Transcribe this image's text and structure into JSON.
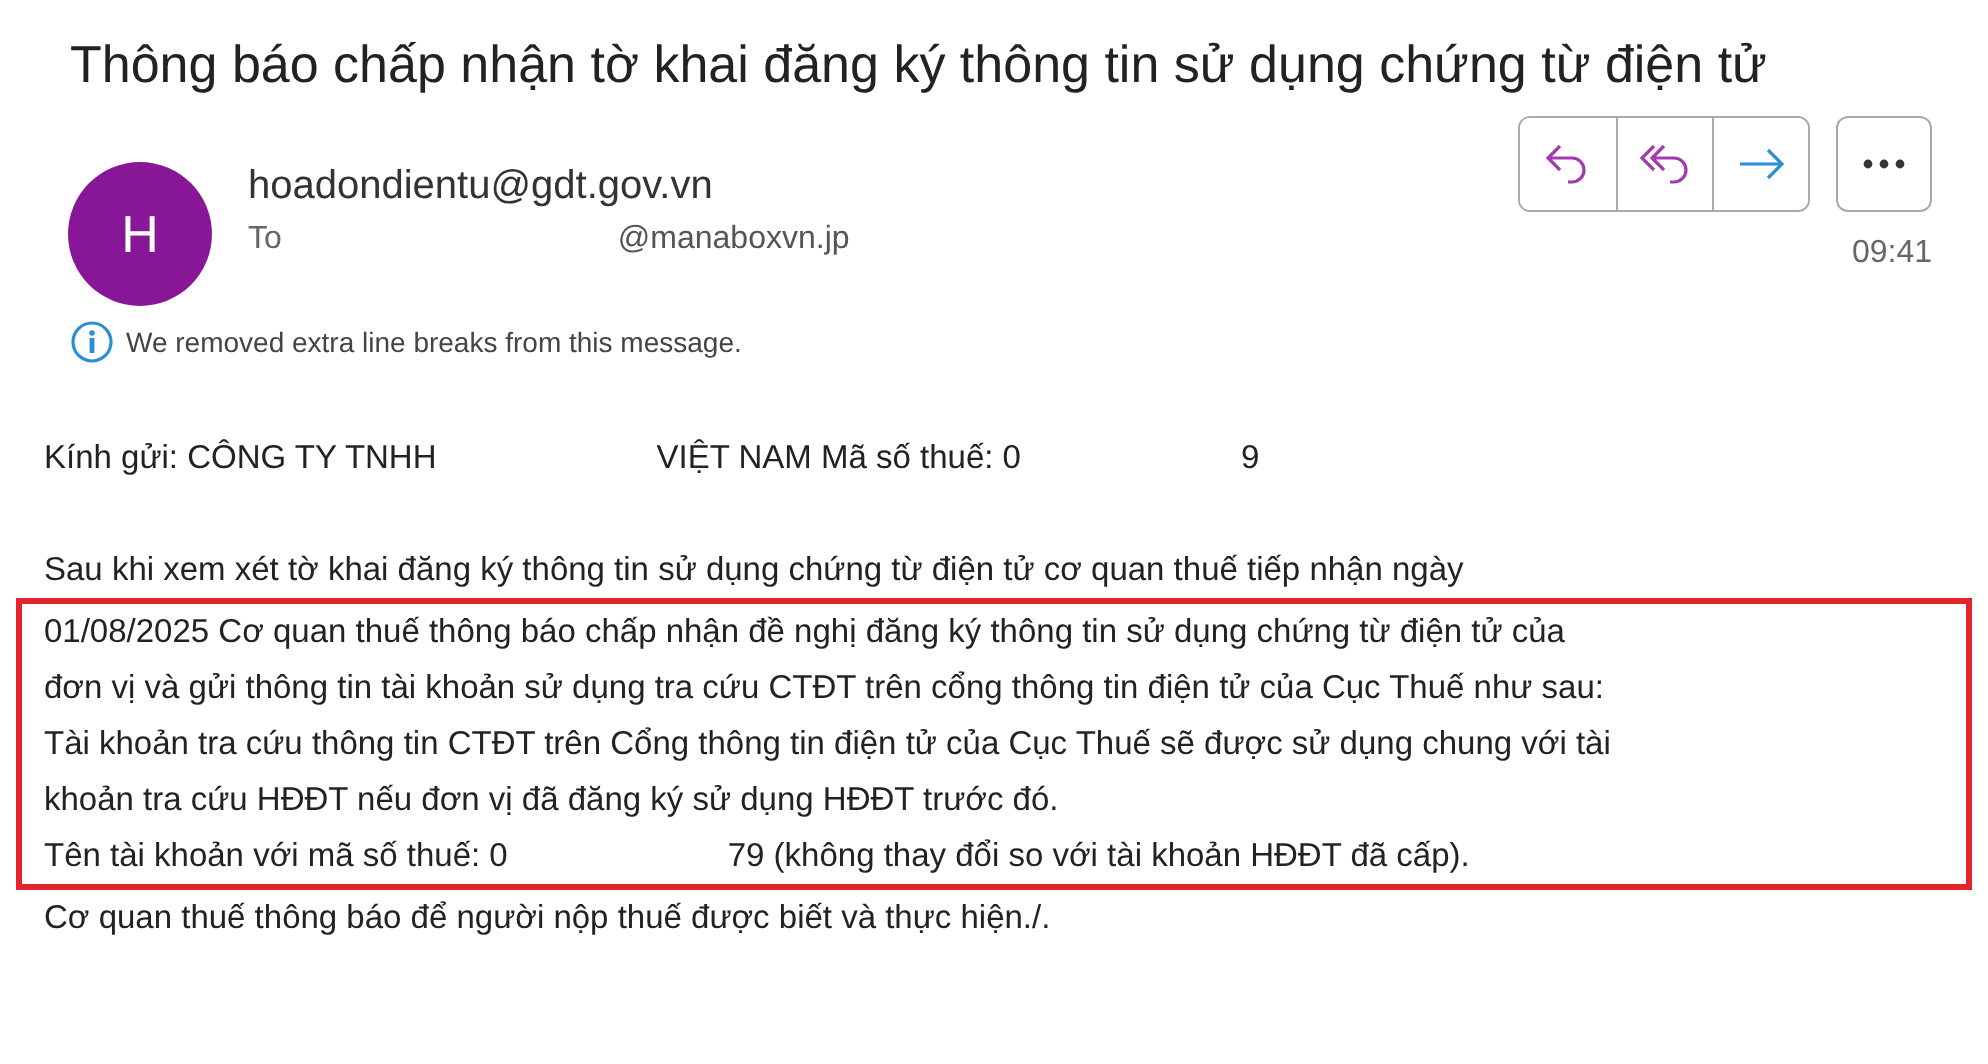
{
  "title": "Thông báo chấp nhận tờ khai đăng ký thông tin sử dụng chứng từ điện tử",
  "sender": {
    "initial": "H",
    "address": "hoadondientu@gdt.gov.vn",
    "to_label": "To",
    "to_address": "@manaboxvn.jp",
    "time": "09:41"
  },
  "actions": [
    {
      "kind": "reply"
    },
    {
      "kind": "reply_all"
    },
    {
      "kind": "forward"
    }
  ],
  "info": "We removed extra line breaks from this message.",
  "body": [
    {
      "kind": "lines",
      "highlighted": false,
      "lines": [
        [
          {
            "kind": "text",
            "text": "Kính gửi: CÔNG TY TNHH"
          },
          {
            "kind": "redacted"
          },
          {
            "kind": "text",
            "text": "VIỆT NAM Mã số thuế: 0"
          },
          {
            "kind": "redacted"
          },
          {
            "kind": "text",
            "text": "9"
          }
        ]
      ]
    },
    {
      "kind": "blank"
    },
    {
      "kind": "lines",
      "highlighted": false,
      "lines": [
        [
          {
            "kind": "text",
            "text": "Sau khi xem xét tờ khai đăng ký thông tin sử dụng chứng từ điện tử cơ quan thuế tiếp nhận ngày"
          }
        ]
      ]
    },
    {
      "kind": "lines",
      "highlighted": true,
      "lines": [
        [
          {
            "kind": "text",
            "text": "01/08/2025 Cơ quan thuế thông báo chấp nhận đề nghị đăng ký thông tin sử dụng chứng từ điện tử của"
          }
        ],
        [
          {
            "kind": "text",
            "text": "đơn vị và gửi thông tin tài khoản sử dụng tra cứu CTĐT trên cổng thông tin điện tử của Cục Thuế như sau:"
          }
        ],
        [
          {
            "kind": "text",
            "text": "Tài khoản tra cứu thông tin CTĐT trên Cổng thông tin điện tử của Cục Thuế sẽ được sử dụng chung với tài"
          }
        ],
        [
          {
            "kind": "text",
            "text": "khoản tra cứu HĐĐT nếu đơn vị đã đăng ký sử dụng HĐĐT trước đó."
          }
        ],
        [
          {
            "kind": "text",
            "text": "Tên tài khoản với mã số thuế: 0"
          },
          {
            "kind": "redacted"
          },
          {
            "kind": "text",
            "text": "79 (không thay đổi so với tài khoản HĐĐT đã cấp)."
          }
        ]
      ]
    },
    {
      "kind": "lines",
      "highlighted": false,
      "lines": [
        [
          {
            "kind": "text",
            "text": "Cơ quan thuế thông báo để người nộp thuế được biết và thực hiện./."
          }
        ]
      ]
    }
  ]
}
